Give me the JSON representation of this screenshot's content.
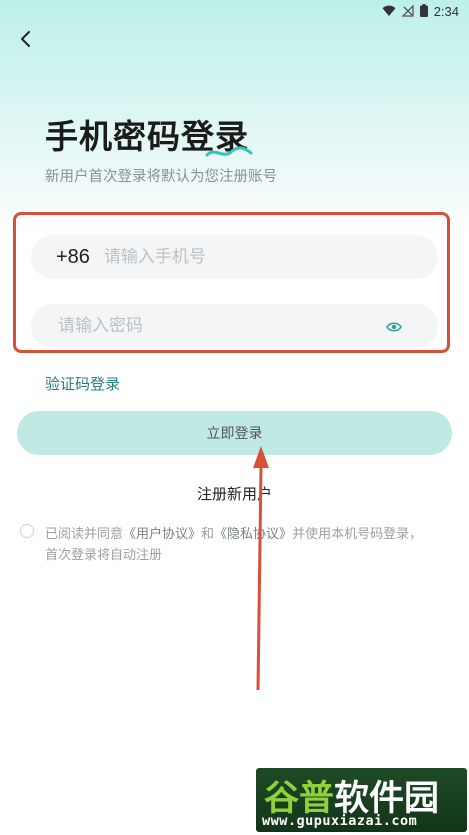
{
  "status": {
    "time": "2:34",
    "icons": [
      "wifi-icon",
      "no-signal-icon",
      "battery-icon"
    ]
  },
  "header": {
    "back_icon": "chevron-left-icon"
  },
  "title": "手机密码登录",
  "subtitle": "新用户首次登录将默认为您注册账号",
  "phone": {
    "country_code": "+86",
    "placeholder": "请输入手机号",
    "value": ""
  },
  "password": {
    "placeholder": "请输入密码",
    "value": "",
    "eye_icon": "eye-icon"
  },
  "sms_login_label": "验证码登录",
  "login_button_label": "立即登录",
  "register_label": "注册新用户",
  "agreement": {
    "prefix": "已阅读并同意",
    "user_agreement": "《用户协议》",
    "and": "和",
    "privacy_agreement": "《隐私协议》",
    "suffix": "并使用本机号码登录，首次登录将自动注册"
  },
  "watermark": {
    "brand": "谷普软件园",
    "url": "www.gupuxiazai.com"
  },
  "colors": {
    "accent": "#2b7d79",
    "button_bg": "#bfe9e3",
    "highlight": "#d6503a",
    "eye": "#2aa39b"
  }
}
